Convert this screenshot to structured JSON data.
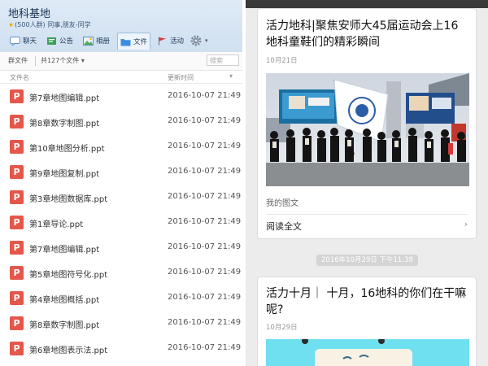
{
  "left": {
    "group": {
      "title": "地科基地",
      "subtitle": "(500人群) 同事,朋友-同学"
    },
    "tabs": [
      {
        "label": "聊天",
        "icon": "chat-icon"
      },
      {
        "label": "公告",
        "icon": "announcement-icon"
      },
      {
        "label": "相册",
        "icon": "photo-album-icon"
      },
      {
        "label": "文件",
        "icon": "folder-icon",
        "active": true
      },
      {
        "label": "活动",
        "icon": "flag-icon"
      },
      {
        "label": "",
        "icon": "gear-icon"
      }
    ],
    "toolbar": {
      "files_label": "群文件",
      "count_label": "共127个文件",
      "search_placeholder": "搜索"
    },
    "columns": {
      "name": "文件名",
      "time": "更新时间"
    },
    "files": [
      {
        "name": "第7章地图编辑.ppt",
        "time": "2016-10-07 21:49"
      },
      {
        "name": "第8章数字制图.ppt",
        "time": "2016-10-07 21:49"
      },
      {
        "name": "第10章地图分析.ppt",
        "time": "2016-10-07 21:49"
      },
      {
        "name": "第9章地图复制.ppt",
        "time": "2016-10-07 21:49"
      },
      {
        "name": "第3章地图数据库.ppt",
        "time": "2016-10-07 21:49"
      },
      {
        "name": "第1章导论.ppt",
        "time": "2016-10-07 21:49"
      },
      {
        "name": "第7章地图编辑.ppt",
        "time": "2016-10-07 21:49"
      },
      {
        "name": "第5章地图符号化.ppt",
        "time": "2016-10-07 21:49"
      },
      {
        "name": "第4章地图概括.ppt",
        "time": "2016-10-07 21:49"
      },
      {
        "name": "第8章数字制图.ppt",
        "time": "2016-10-07 21:49"
      },
      {
        "name": "第6章地图表示法.ppt",
        "time": "2016-10-07 21:49"
      }
    ],
    "file_icon_letter": "P",
    "file_icon_color": "#e5564b"
  },
  "right": {
    "card1": {
      "title": "活力地科|聚焦安师大45届运动会上16地科童鞋们的精彩瞬间",
      "date": "10月21日",
      "desc": "我的图文",
      "readmore": "阅读全文"
    },
    "timestamp": "2016年10月29日 下午11:38",
    "card2": {
      "title": "活力十月｜ 十月，16地科的你们在干嘛呢?",
      "date": "10月29日"
    }
  }
}
